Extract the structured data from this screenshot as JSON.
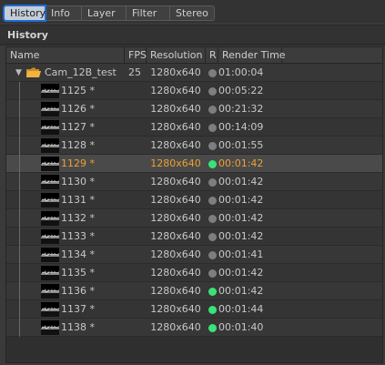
{
  "tabs": [
    {
      "label": "History",
      "active": true
    },
    {
      "label": "Info",
      "active": false
    },
    {
      "label": "Layer",
      "active": false
    },
    {
      "label": "Filter",
      "active": false
    },
    {
      "label": "Stereo",
      "active": false
    }
  ],
  "panel": {
    "title": "History"
  },
  "columns": {
    "name": "Name",
    "fps": "FPS",
    "resolution": "Resolution",
    "r": "R",
    "render_time": "Render Time"
  },
  "folder": {
    "name": "Cam_12B_test",
    "fps": "25",
    "resolution": "1280x640",
    "status": "gray",
    "render_time": "01:00:04"
  },
  "rows": [
    {
      "name": "1125 *",
      "resolution": "1280x640",
      "status": "gray",
      "render_time": "00:05:22"
    },
    {
      "name": "1126 *",
      "resolution": "1280x640",
      "status": "gray",
      "render_time": "00:21:32"
    },
    {
      "name": "1127 *",
      "resolution": "1280x640",
      "status": "gray",
      "render_time": "00:14:09"
    },
    {
      "name": "1128 *",
      "resolution": "1280x640",
      "status": "gray",
      "render_time": "00:01:55"
    },
    {
      "name": "1129 *",
      "resolution": "1280x640",
      "status": "green",
      "render_time": "00:01:42",
      "selected": true
    },
    {
      "name": "1130 *",
      "resolution": "1280x640",
      "status": "gray",
      "render_time": "00:01:42"
    },
    {
      "name": "1131 *",
      "resolution": "1280x640",
      "status": "gray",
      "render_time": "00:01:42"
    },
    {
      "name": "1132 *",
      "resolution": "1280x640",
      "status": "gray",
      "render_time": "00:01:42"
    },
    {
      "name": "1133 *",
      "resolution": "1280x640",
      "status": "gray",
      "render_time": "00:01:42"
    },
    {
      "name": "1134 *",
      "resolution": "1280x640",
      "status": "gray",
      "render_time": "00:01:41"
    },
    {
      "name": "1135 *",
      "resolution": "1280x640",
      "status": "gray",
      "render_time": "00:01:42"
    },
    {
      "name": "1136 *",
      "resolution": "1280x640",
      "status": "green",
      "render_time": "00:01:42"
    },
    {
      "name": "1137 *",
      "resolution": "1280x640",
      "status": "green",
      "render_time": "00:01:44"
    },
    {
      "name": "1138 *",
      "resolution": "1280x640",
      "status": "green",
      "render_time": "00:01:40"
    }
  ],
  "colors": {
    "accent": "#1e6bd6",
    "selected_text": "#f0a030",
    "status_green": "#39e37a",
    "status_gray": "#7e7e7e"
  }
}
